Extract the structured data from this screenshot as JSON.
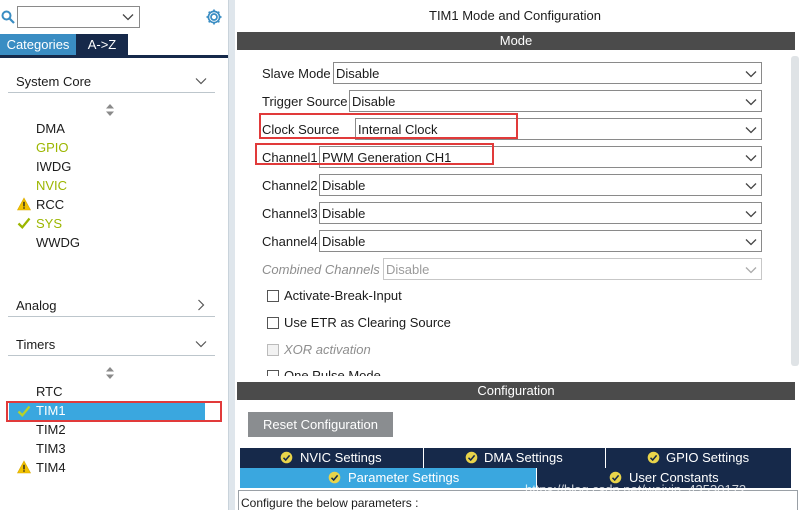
{
  "left_panel": {
    "search": {
      "value": ""
    },
    "tabs": {
      "categories": "Categories",
      "az": "A->Z"
    },
    "sections": {
      "system_core": "System Core",
      "analog": "Analog",
      "timers": "Timers"
    },
    "system_core_items": [
      {
        "label": "DMA",
        "status": "none",
        "color": "normal"
      },
      {
        "label": "GPIO",
        "status": "none",
        "color": "green"
      },
      {
        "label": "IWDG",
        "status": "none",
        "color": "normal"
      },
      {
        "label": "NVIC",
        "status": "none",
        "color": "green"
      },
      {
        "label": "RCC",
        "status": "warning",
        "color": "normal"
      },
      {
        "label": "SYS",
        "status": "ok",
        "color": "green"
      },
      {
        "label": "WWDG",
        "status": "none",
        "color": "normal"
      }
    ],
    "timer_items": [
      {
        "label": "RTC",
        "status": "none"
      },
      {
        "label": "TIM1",
        "status": "ok",
        "selected": true
      },
      {
        "label": "TIM2",
        "status": "none"
      },
      {
        "label": "TIM3",
        "status": "none"
      },
      {
        "label": "TIM4",
        "status": "warning"
      }
    ]
  },
  "right_panel": {
    "title": "TIM1 Mode and Configuration",
    "mode_header": "Mode",
    "mode_rows": [
      {
        "label": "Slave Mode",
        "value": "Disable",
        "enabled": true
      },
      {
        "label": "Trigger Source",
        "value": "Disable",
        "enabled": true
      },
      {
        "label": "Clock Source",
        "value": "Internal Clock",
        "enabled": true,
        "highlighted": true
      },
      {
        "label": "Channel1",
        "value": "PWM Generation CH1",
        "enabled": true,
        "highlighted": true
      },
      {
        "label": "Channel2",
        "value": "Disable",
        "enabled": true
      },
      {
        "label": "Channel3",
        "value": "Disable",
        "enabled": true
      },
      {
        "label": "Channel4",
        "value": "Disable",
        "enabled": true
      },
      {
        "label": "Combined Channels",
        "value": "Disable",
        "enabled": false
      }
    ],
    "checkboxes": [
      {
        "label": "Activate-Break-Input",
        "checked": false,
        "enabled": true
      },
      {
        "label": "Use ETR as Clearing Source",
        "checked": false,
        "enabled": true
      },
      {
        "label": "XOR activation",
        "checked": false,
        "enabled": false
      },
      {
        "label": "One Pulse Mode",
        "checked": false,
        "enabled": true
      }
    ],
    "config_header": "Configuration",
    "reset_button": "Reset Configuration",
    "settings_tabs_row1": [
      "NVIC Settings",
      "DMA Settings",
      "GPIO Settings"
    ],
    "settings_tabs_row2": [
      "Parameter Settings",
      "User Constants"
    ],
    "params_text": "Configure the below parameters :",
    "watermark": "https://blog.csdn.net/weixin_43530172"
  },
  "colors": {
    "accent_blue": "#3aa7df",
    "navy": "#16294a",
    "header_gray": "#4b4b4b",
    "highlight_red": "#e13a3a",
    "active_green": "#9cb600",
    "warning_yellow": "#f2c200"
  },
  "icons": {
    "search": "search-icon",
    "settings": "gear-icon",
    "ok": "check-icon",
    "warning": "warning-icon"
  }
}
